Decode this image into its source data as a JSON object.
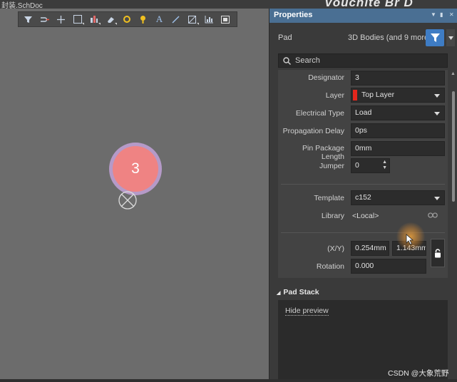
{
  "window": {
    "doc_title": "封装.SchDoc",
    "brand_text": "Vouchite Br D"
  },
  "toolbar": {
    "items": [
      {
        "icon": "filter-icon"
      },
      {
        "icon": "snap-icon"
      },
      {
        "icon": "crosshair-icon"
      },
      {
        "icon": "rectangle-select-icon"
      },
      {
        "icon": "align-icon"
      },
      {
        "icon": "eraser-icon"
      },
      {
        "icon": "pad-place-icon"
      },
      {
        "icon": "via-place-icon"
      },
      {
        "icon": "text-icon",
        "label": "A"
      },
      {
        "icon": "line-icon"
      },
      {
        "icon": "region-icon"
      },
      {
        "icon": "chart-icon"
      },
      {
        "icon": "board-icon"
      }
    ]
  },
  "canvas": {
    "pad_designator": "3",
    "pad_fill_color": "#ef8383",
    "pad_glow_color": "#b59ac8"
  },
  "panel": {
    "title": "Properties",
    "object_kind": "Pad",
    "filter_summary": "3D Bodies (and 9 more)",
    "search_placeholder": "Search",
    "accent_color": "#3e7cc4",
    "fields": {
      "designator": {
        "label": "Designator",
        "value": "3"
      },
      "layer": {
        "label": "Layer",
        "value": "Top Layer",
        "swatch_color": "#e3261c"
      },
      "electrical_type": {
        "label": "Electrical Type",
        "value": "Load"
      },
      "propagation_delay": {
        "label": "Propagation Delay",
        "value": "0ps"
      },
      "pin_package_length": {
        "label": "Pin Package Length",
        "value": "0mm"
      },
      "jumper": {
        "label": "Jumper",
        "value": "0"
      },
      "template": {
        "label": "Template",
        "value": "c152"
      },
      "library": {
        "label": "Library",
        "value": "<Local>"
      },
      "xy": {
        "label": "(X/Y)",
        "x": "0.254mm",
        "y": "1.143mm"
      },
      "rotation": {
        "label": "Rotation",
        "value": "0.000"
      }
    },
    "pad_stack": {
      "title": "Pad Stack",
      "hide_preview_label": "Hide preview"
    }
  },
  "watermark": "CSDN @大象荒野"
}
